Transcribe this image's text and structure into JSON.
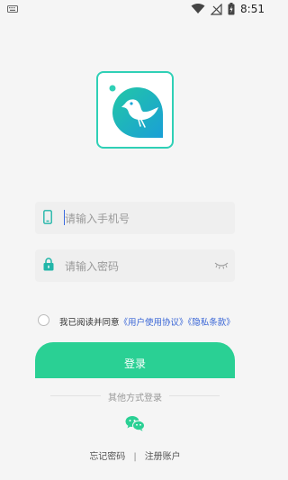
{
  "status_bar": {
    "time": "8:51",
    "icons": [
      "keyboard-icon",
      "wifi-icon",
      "no-signal-icon",
      "battery-icon"
    ]
  },
  "logo": {
    "icon": "bird-logo-icon",
    "colors": {
      "primary": "#2fd0b6",
      "accent": "#1aa5d8"
    }
  },
  "form": {
    "phone_placeholder": "请输入手机号",
    "password_placeholder": "请输入密码",
    "phone_icon": "phone-icon",
    "lock_icon": "lock-icon",
    "eye_icon": "eye-closed-icon"
  },
  "agreement": {
    "prefix": "我已阅读并同意",
    "user_agreement": "《用户使用协议》",
    "privacy_policy": "《隐私条款》",
    "checked": false
  },
  "login_button": {
    "label": "登录",
    "color": "#2ad094"
  },
  "other_login": {
    "label": "其他方式登录",
    "wechat_icon": "wechat-icon"
  },
  "bottom": {
    "forgot": "忘记密码",
    "separator": "|",
    "register": "注册账户"
  }
}
